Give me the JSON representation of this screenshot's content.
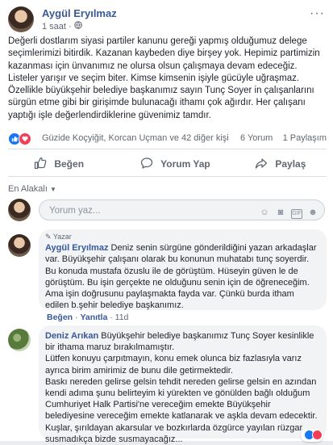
{
  "post": {
    "author": "Aygül Eryılmaz",
    "time": "1 saat",
    "privacy_icon": "globe-icon",
    "more_label": "···",
    "text": "Değerli dostlarım siyasi partiler kanunu gereği yapmış olduğumuz delege seçimlerimizi bitirdik. Kazanan kaybeden diye birşey yok. Hepimiz partimizin kazanması için ünvanımız ne olursa olsun çalışmaya devam edeceğiz. Listeler yarışır ve seçim biter. Kimse kimsenin işiyle gücüyle uğraşmaz. Özellikle büyükşehir belediye başkanımız sayın Tunç Soyer in çalışanlarını sürgün etme gibi bir girişimde bulunacağı ithamı çok ağırdır. Her çalışanı yaptığı işle değerlendirdiklerine güvenimiz tamdır."
  },
  "reactions": {
    "names": "Güzide Koçyiğit, Korcan Uçman ve 42 diğer kişi",
    "comments": "6 Yorum",
    "shares": "1 Paylaşım"
  },
  "actions": {
    "like": "Beğen",
    "comment": "Yorum Yap",
    "share": "Paylaş"
  },
  "comments_section": {
    "sort_label": "En Alakalı",
    "input_placeholder": "Yorum yaz..."
  },
  "comments": [
    {
      "badge": "Yazar",
      "author": "Aygül Eryılmaz",
      "text": "Deniz senin sürgüne gönderildiğini yazan arkadaşlar var. Büyükşehir çalışanı olarak bu konunun muhatabı tunç soyerdir. Bu konuda mustafa özuslu ile de görüştüm. Hüseyin güven le de görüştüm. Bu işin gerçekte ne olduğunu senin için de öğreneceğim. Ama işin doğrusunu paylaşmakta fayda var. Çünkü burda itham edilen b.şehir belediye başkanımız.",
      "like_label": "Beğen",
      "reply_label": "Yanıtla",
      "time": "11d"
    },
    {
      "author": "Deniz Arıkan",
      "text_p1": "Büyükşehir belediye başkanımız Tunç Soyer kesinlikle bir ithama maruz bırakılmamıştır.",
      "text_p2": "Lütfen konuyu çarpıtmayın, konu emek olunca biz fazlasıyla varız ayrıca birim amirimiz de bunu dile getirmektedir.",
      "text_p3": "Baskı nereden gelirse gelsin tehdit nereden gelirse gelsin en azından kendi adıma şunu belirteyim ki yürekten ve gönülden bağlı olduğum Cumhuriyet Halk Partisi'ne vereceğim emekte Büyükşehir belediyesine vereceğim emekte katlanarak ve aşkla devam edecektir.",
      "text_p4": "Kuşlar, şırıldayan akarsular ve bozkırlarda özgürce yayılan rüzgar susmadıkça bizde susmayacağız..."
    }
  ],
  "colors": {
    "link": "#385898",
    "meta": "#616770",
    "like": "#1877f2",
    "love": "#f33e58"
  }
}
